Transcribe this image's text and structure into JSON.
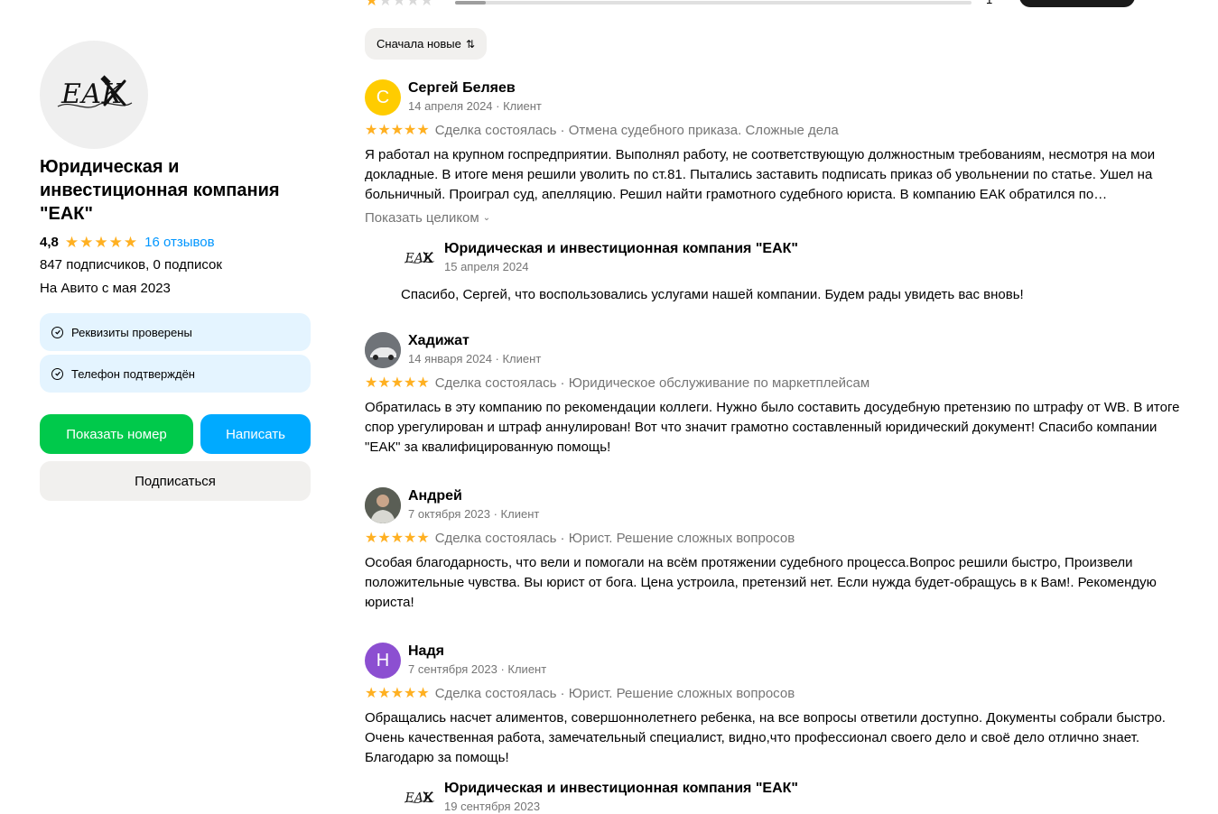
{
  "profile": {
    "name": "Юридическая и инвестиционная компания \"ЕАК\"",
    "logo_initials": "ЕАК",
    "rating": "4,8",
    "reviews_link": "16 отзывов",
    "subscribers": "847 подписчиков, 0 подписок",
    "since": "На Авито с мая 2023",
    "badges": [
      "Реквизиты проверены",
      "Телефон подтверждён"
    ],
    "buttons": {
      "show_phone": "Показать номер",
      "write": "Написать",
      "subscribe": "Подписаться"
    }
  },
  "rating_summary": {
    "row_stars": 1,
    "row_count": "1",
    "row_fill_fraction": 0.06
  },
  "sort": {
    "label": "Сначала новые"
  },
  "reviews": [
    {
      "author": "Сергей Беляев",
      "avatar_letter": "С",
      "avatar_color": "#ffcc00",
      "date": "14 апреля 2024 · Клиент",
      "stars": 5,
      "line": "Сделка состоялась · Отмена судебного приказа. Сложные дела",
      "text": "Я работал на крупном госпредприятии. Выполнял работу, не соответствующую должностным требованиям, несмотря на мои докладные. В итоге меня решили уволить по ст.81. Пытались заставить подписать приказ об увольнении по статье. Ушел на больничный. Проиграл суд, апелляцию. Решил найти грамотного судебного юриста. В компанию ЕАК обратился по…",
      "show_more": "Показать целиком",
      "reply": {
        "author": "Юридическая и инвестиционная компания \"ЕАК\"",
        "date": "15 апреля 2024",
        "text": "Спасибо, Сергей, что воспользовались услугами нашей компании. Будем рады увидеть вас вновь!"
      }
    },
    {
      "author": "Хадижат",
      "avatar_letter": "",
      "avatar_color": "#8a8f95",
      "date": "14 января 2024 · Клиент",
      "stars": 5,
      "line": "Сделка состоялась · Юридическое обслуживание по маркетплейсам",
      "text": "Обратилась в эту компанию по рекомендации коллеги. Нужно было составить досудебную претензию по штрафу от WB. В итоге спор урегулирован и штраф аннулирован! Вот что значит грамотно составленный юридический документ! Спасибо компании \"ЕАК\" за квалифицированную помощь!"
    },
    {
      "author": "Андрей",
      "avatar_letter": "",
      "avatar_color": "#6b6f63",
      "date": "7 октября 2023 · Клиент",
      "stars": 5,
      "line": "Сделка состоялась · Юрист. Решение сложных вопросов",
      "text": "Особая благодарность, что вели и помогали на всём протяжении судебного процесса.Вопрос решили быстро, Произвели положительные чувства. Вы юрист от бога. Цена устроила, претензий нет. Если нужда будет-обращусь в к Вам!. Рекомендую юриста!"
    },
    {
      "author": "Надя",
      "avatar_letter": "Н",
      "avatar_color": "#8c4fd1",
      "date": "7 сентября 2023 · Клиент",
      "stars": 5,
      "line": "Сделка состоялась · Юрист. Решение сложных вопросов",
      "text": "Обращались насчет алиментов, совершоннолетнего ребенка, на все вопросы ответили доступно. Документы собрали быстро. Очень качественная работа, замечательный специалист, видно,что профессионал своего дело и своё дело отлично знает. Благодарю за помощь!",
      "reply": {
        "author": "Юридическая и инвестиционная компания \"ЕАК\"",
        "date": "19 сентября 2023"
      }
    }
  ],
  "colors": {
    "star": "#ffb021",
    "green_button": "#00c94b",
    "blue_button": "#00aaff",
    "link": "#0096ff",
    "badge_bg": "#e4f4ff"
  }
}
